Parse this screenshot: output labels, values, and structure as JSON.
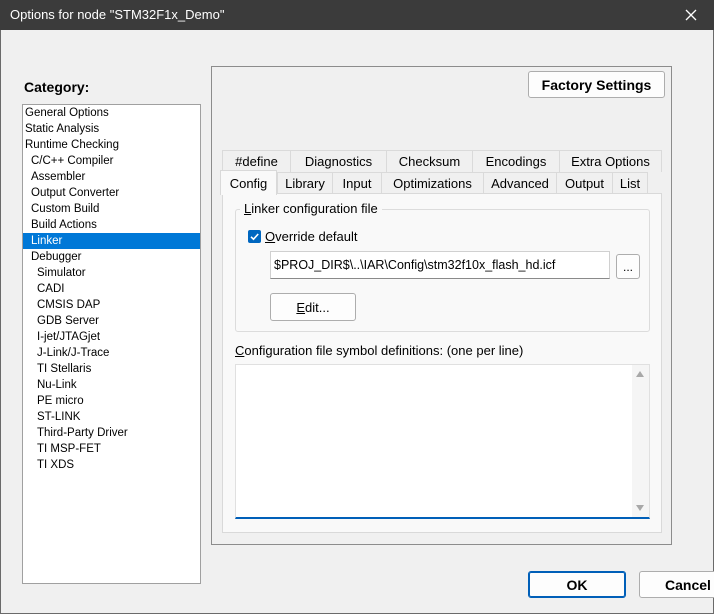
{
  "window": {
    "title": "Options for node \"STM32F1x_Demo\"",
    "close_icon": "close-icon"
  },
  "category": {
    "label": "Category:",
    "selected": "Linker",
    "items": [
      {
        "label": "General Options",
        "level": 0
      },
      {
        "label": "Static Analysis",
        "level": 0
      },
      {
        "label": "Runtime Checking",
        "level": 0
      },
      {
        "label": "C/C++ Compiler",
        "level": 1
      },
      {
        "label": "Assembler",
        "level": 1
      },
      {
        "label": "Output Converter",
        "level": 1
      },
      {
        "label": "Custom Build",
        "level": 1
      },
      {
        "label": "Build Actions",
        "level": 1
      },
      {
        "label": "Linker",
        "level": 1
      },
      {
        "label": "Debugger",
        "level": 1
      },
      {
        "label": "Simulator",
        "level": 2
      },
      {
        "label": "CADI",
        "level": 2
      },
      {
        "label": "CMSIS DAP",
        "level": 2
      },
      {
        "label": "GDB Server",
        "level": 2
      },
      {
        "label": "I-jet/JTAGjet",
        "level": 2
      },
      {
        "label": "J-Link/J-Trace",
        "level": 2
      },
      {
        "label": "TI Stellaris",
        "level": 2
      },
      {
        "label": "Nu-Link",
        "level": 2
      },
      {
        "label": "PE micro",
        "level": 2
      },
      {
        "label": "ST-LINK",
        "level": 2
      },
      {
        "label": "Third-Party Driver",
        "level": 2
      },
      {
        "label": "TI MSP-FET",
        "level": 2
      },
      {
        "label": "TI XDS",
        "level": 2
      }
    ]
  },
  "factory_settings_label": "Factory Settings",
  "tabs_row1": [
    "#define",
    "Diagnostics",
    "Checksum",
    "Encodings",
    "Extra Options"
  ],
  "tabs_row2": [
    "Config",
    "Library",
    "Input",
    "Optimizations",
    "Advanced",
    "Output",
    "List"
  ],
  "active_tab": "Config",
  "config": {
    "group_title_u": "L",
    "group_title_rest": "inker configuration file",
    "override_checked": true,
    "override_u": "O",
    "override_rest": "verride default",
    "path_value": "$PROJ_DIR$\\..\\IAR\\Config\\stm32f10x_flash_hd.icf",
    "browse_label": "...",
    "edit_u": "E",
    "edit_rest": "dit...",
    "defs_u": "C",
    "defs_rest": "onfiguration file symbol definitions: (one per line)",
    "defs_value": ""
  },
  "footer": {
    "ok_label": "OK",
    "cancel_label": "Cancel"
  }
}
